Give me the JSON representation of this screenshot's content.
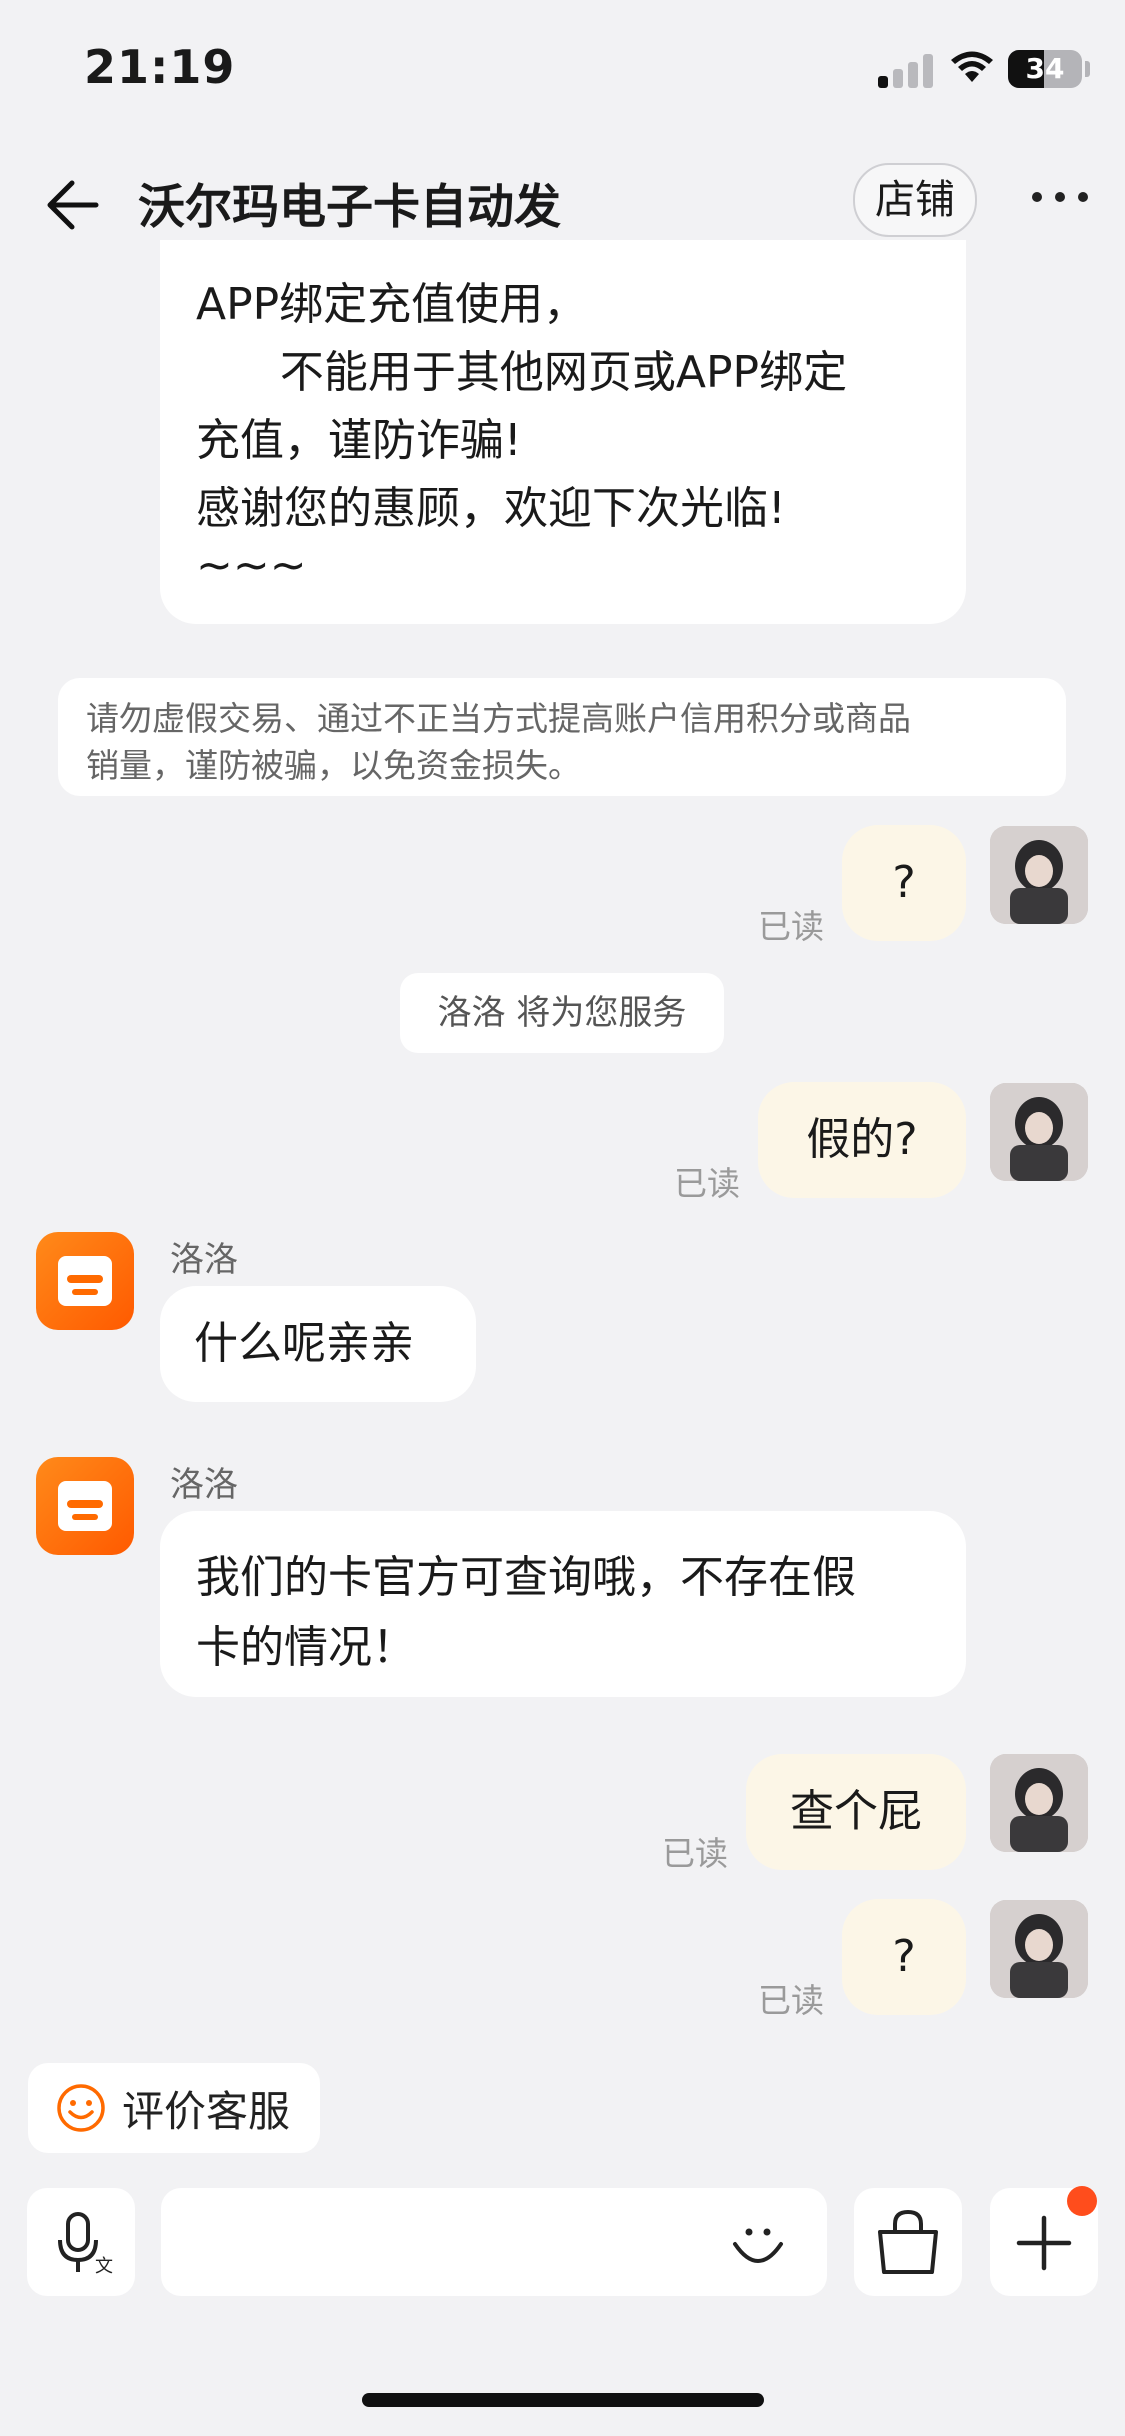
{
  "status_bar": {
    "time": "21:19",
    "battery": "34"
  },
  "header": {
    "title": "沃尔玛电子卡自动发",
    "store_label": "店铺"
  },
  "top_message": {
    "lines": [
      "APP绑定充值使用，",
      "      不能用于其他网页或APP绑定",
      "充值，谨防诈骗!",
      "感谢您的惠顾，欢迎下次光临!",
      "~~~"
    ]
  },
  "notice": {
    "lines": [
      "请勿虚假交易、通过不正当方式提高账户信用积分或商品",
      "销量，谨防被骗，以免资金损失。"
    ]
  },
  "system_message": "洛洛 将为您服务",
  "messages": [
    {
      "from": "me",
      "text": "?",
      "status": "已读"
    },
    {
      "from": "me",
      "text": "假的?",
      "status": "已读"
    },
    {
      "from": "shop",
      "sender": "洛洛",
      "text": "什么呢亲亲"
    },
    {
      "from": "shop",
      "sender": "洛洛",
      "lines": [
        "我们的卡官方可查询哦，不存在假",
        "卡的情况！"
      ]
    },
    {
      "from": "me",
      "text": "查个屁",
      "status": "已读"
    },
    {
      "from": "me",
      "text": "?",
      "status": "已读"
    }
  ],
  "rating": {
    "label": "评价客服"
  },
  "input_bar": {
    "voice_icon": "microphone-translate-icon",
    "emoji_icon": "smile-icon",
    "cart_icon": "shopping-bag-icon",
    "plus_icon": "plus-icon",
    "badge_color": "#ff4d1c"
  },
  "colors": {
    "accent": "#ff6a00",
    "my_bubble": "#fcf6e7",
    "background": "#f2f2f4"
  }
}
